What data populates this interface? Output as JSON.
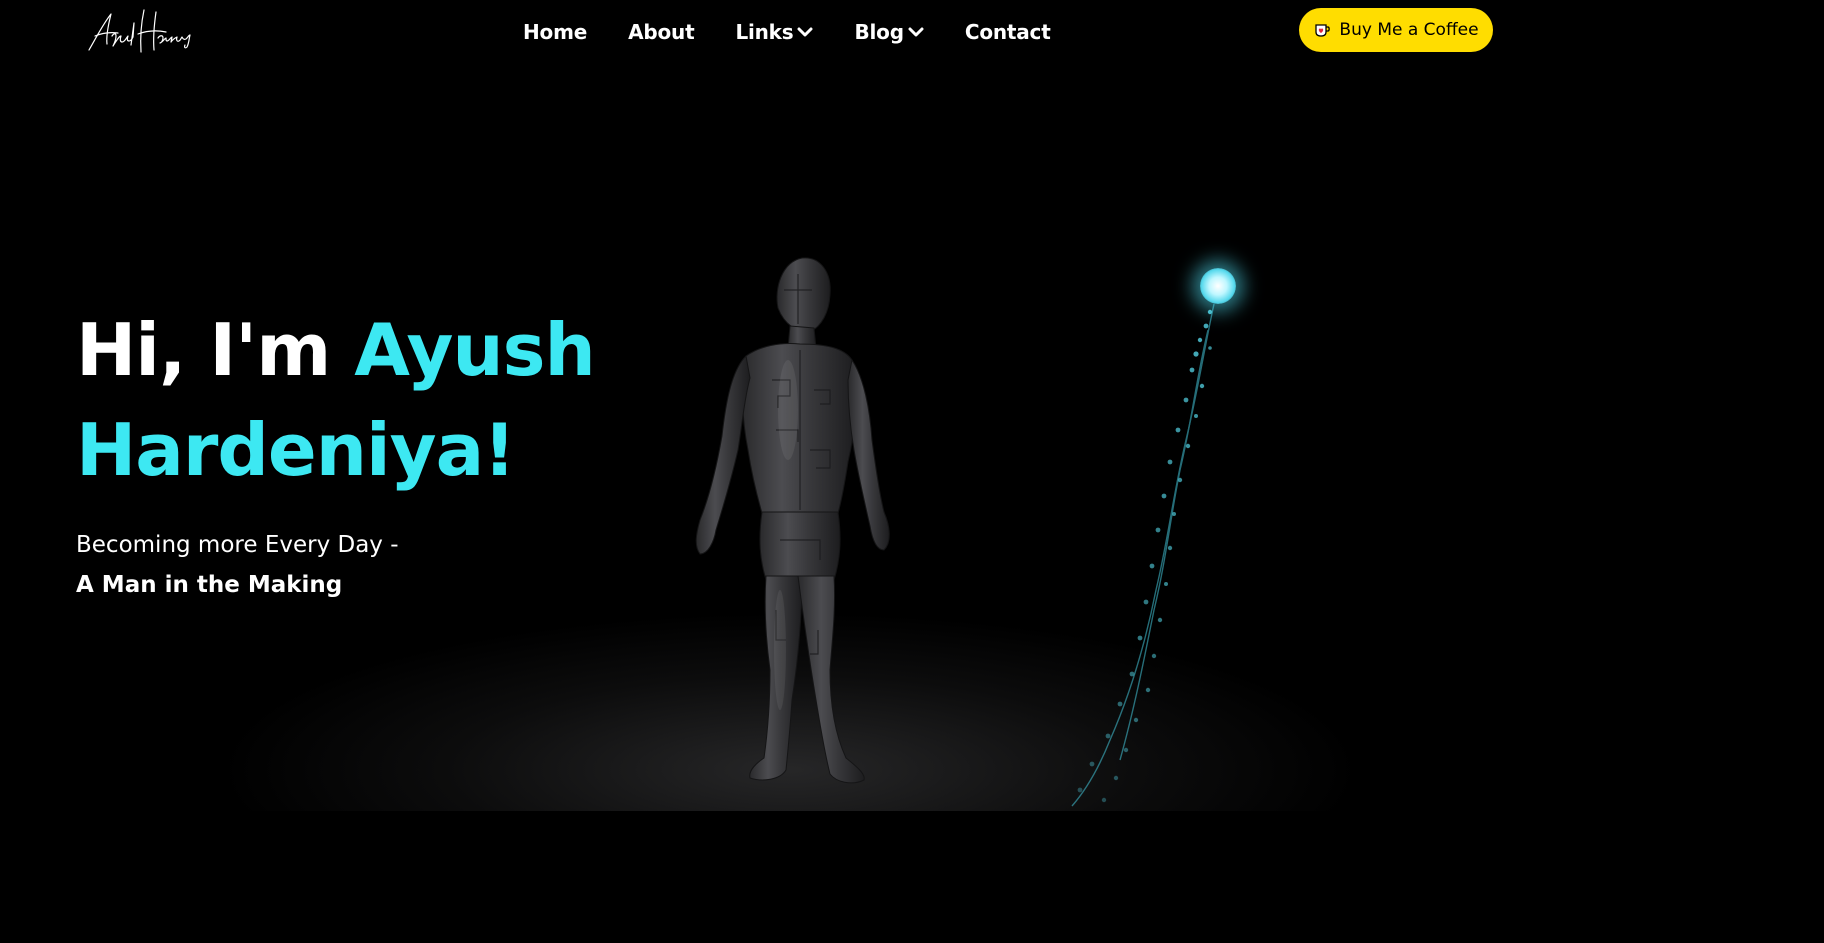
{
  "header": {
    "logo_text": "Ayush Hardeniya",
    "nav": [
      {
        "label": "Home",
        "has_dropdown": false
      },
      {
        "label": "About",
        "has_dropdown": false
      },
      {
        "label": "Links",
        "has_dropdown": true
      },
      {
        "label": "Blog",
        "has_dropdown": true
      },
      {
        "label": "Contact",
        "has_dropdown": false
      }
    ],
    "cta": {
      "label": "Buy Me a Coffee",
      "icon": "coffee-cup-icon",
      "color": "#FFDD00"
    }
  },
  "hero": {
    "greeting": "Hi, I'm ",
    "first_name": "Ayush",
    "last_name": "Hardeniya!",
    "subtitle_line1": "Becoming more Every Day -",
    "subtitle_line2": "A Man in the Making"
  },
  "colors": {
    "background": "#000000",
    "accent": "#3DE8F2",
    "text": "#FFFFFF"
  },
  "scene": {
    "figure": "humanoid-3d-figure",
    "particle_orb": "glowing-particle-orb"
  }
}
